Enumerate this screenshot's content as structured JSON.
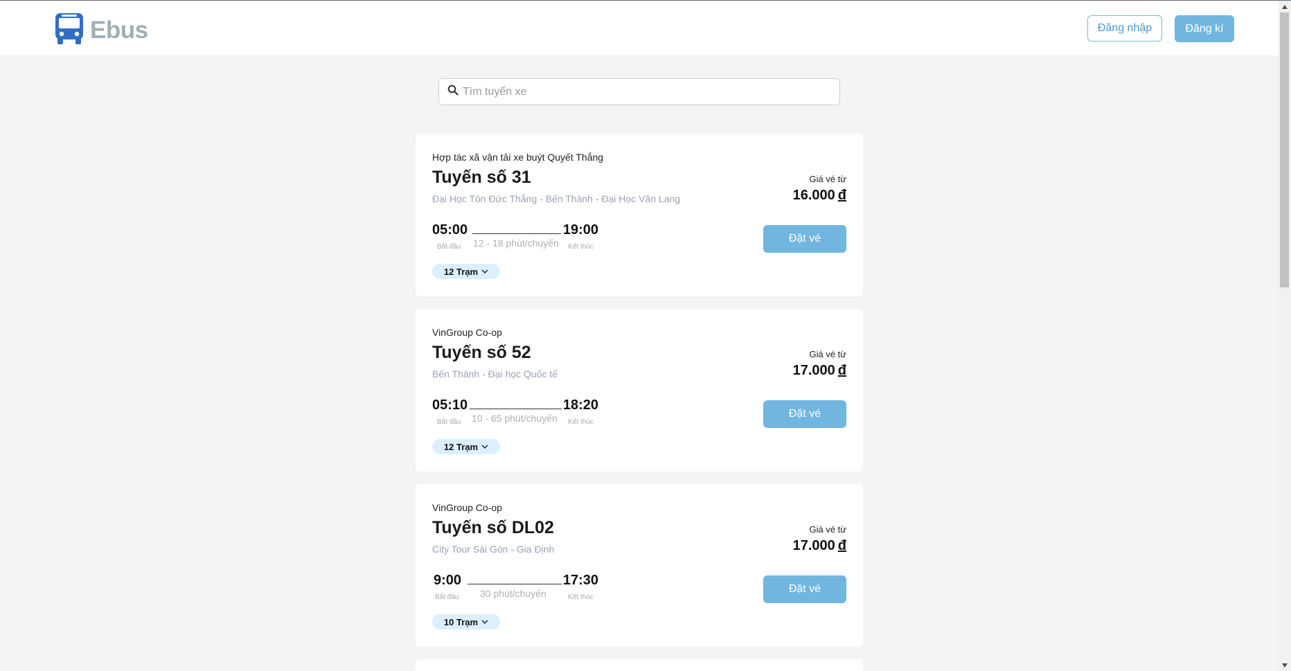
{
  "header": {
    "brand": "Ebus",
    "login_label": "Đăng nhập",
    "register_label": "Đăng kí"
  },
  "search": {
    "placeholder": "Tìm tuyến xe"
  },
  "routes": [
    {
      "company": "Hợp tác xã vận tải xe buýt Quyết Thắng",
      "name": "Tuyến số 31",
      "description": "Đại Học Tôn Đức Thắng - Bến Thành - Đại Học Văn Lang",
      "price_label": "Giá vé từ",
      "price": "16.000",
      "currency": "đ",
      "start_time": "05:00",
      "start_label": "Bắt đầu",
      "end_time": "19:00",
      "end_label": "Kết thúc",
      "frequency": "12 - 18 phút/chuyến",
      "stops": "12 Trạm",
      "book_label": "Đặt vé"
    },
    {
      "company": "VinGroup Co-op",
      "name": "Tuyến số 52",
      "description": "Bến Thành - Đại học Quốc tế",
      "price_label": "Giá vé từ",
      "price": "17.000",
      "currency": "đ",
      "start_time": "05:10",
      "start_label": "Bắt đầu",
      "end_time": "18:20",
      "end_label": "Kết thúc",
      "frequency": "10 - 65 phút/chuyến",
      "stops": "12 Trạm",
      "book_label": "Đặt vé"
    },
    {
      "company": "VinGroup Co-op",
      "name": "Tuyến số DL02",
      "description": "City Tour Sài Gòn - Gia Định",
      "price_label": "Giá vé từ",
      "price": "17.000",
      "currency": "đ",
      "start_time": "9:00",
      "start_label": "Bắt đầu",
      "end_time": "17:30",
      "end_label": "Kết thúc",
      "frequency": "30 phút/chuyến",
      "stops": "10 Trạm",
      "book_label": "Đặt vé"
    }
  ],
  "colors": {
    "accent": "#71b6df",
    "logo_icon": "#2f6fc4",
    "logo_text": "#9fb0b6",
    "stops_badge": "#dcefff"
  },
  "icons": {
    "logo": "bus-icon",
    "search": "search-icon",
    "stops_toggle": "chevron-down-icon"
  }
}
